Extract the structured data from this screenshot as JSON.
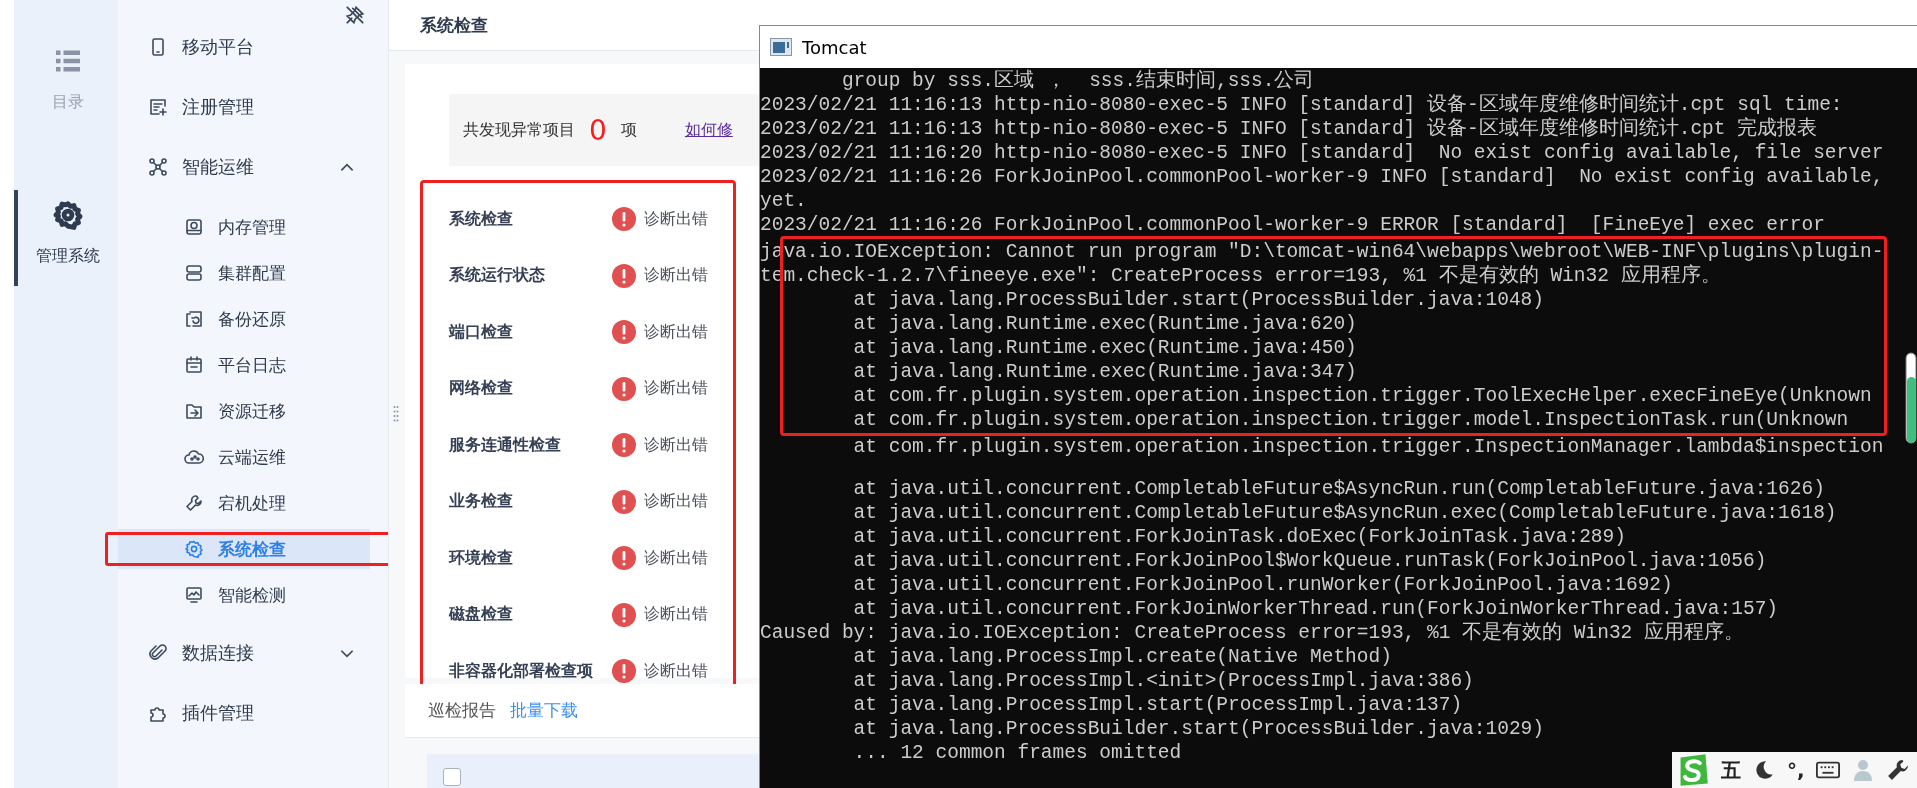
{
  "rail": [
    {
      "label": "目录",
      "selected": false
    },
    {
      "label": "管理系统",
      "selected": true
    }
  ],
  "menu": [
    {
      "label": "移动平台",
      "selected": false,
      "highlighted": false
    },
    {
      "label": "注册管理",
      "selected": false,
      "highlighted": false
    },
    {
      "label": "智能运维",
      "selected": false,
      "highlighted": false,
      "expanded": true,
      "children": [
        {
          "label": "内存管理",
          "selected": false,
          "highlighted": false
        },
        {
          "label": "集群配置",
          "selected": false,
          "highlighted": false
        },
        {
          "label": "备份还原",
          "selected": false,
          "highlighted": false
        },
        {
          "label": "平台日志",
          "selected": false,
          "highlighted": false
        },
        {
          "label": "资源迁移",
          "selected": false,
          "highlighted": false
        },
        {
          "label": "云端运维",
          "selected": false,
          "highlighted": false
        },
        {
          "label": "宕机处理",
          "selected": false,
          "highlighted": false
        },
        {
          "label": "系统检查",
          "selected": true,
          "highlighted": true
        },
        {
          "label": "智能检测",
          "selected": false,
          "highlighted": false
        }
      ]
    },
    {
      "label": "数据连接",
      "selected": false,
      "highlighted": false,
      "expanded": false
    },
    {
      "label": "插件管理",
      "selected": false,
      "highlighted": false
    }
  ],
  "panel": {
    "title": "系统检查",
    "summary": {
      "prefix": "共发现异常项目",
      "count": "0",
      "suffix": "项",
      "link": "如何修"
    },
    "checks_highlighted": true,
    "checks": [
      {
        "name": "系统检查",
        "result": "诊断出错"
      },
      {
        "name": "系统运行状态",
        "result": "诊断出错"
      },
      {
        "name": "端口检查",
        "result": "诊断出错"
      },
      {
        "name": "网络检查",
        "result": "诊断出错"
      },
      {
        "name": "服务连通性检查",
        "result": "诊断出错"
      },
      {
        "name": "业务检查",
        "result": "诊断出错"
      },
      {
        "name": "环境检查",
        "result": "诊断出错"
      },
      {
        "name": "磁盘检查",
        "result": "诊断出错"
      },
      {
        "name": "非容器化部署检查项",
        "result": "诊断出错"
      }
    ],
    "report": {
      "label": "巡检报告",
      "action": "批量下载"
    },
    "table": {
      "select_all": {
        "checked": false
      }
    }
  },
  "console": {
    "title": "Tomcat",
    "blocks": [
      {
        "highlighted": false,
        "lines": [
          "       group by sss.区域 ，  sss.结束时间,sss.公司",
          "2023/02/21 11:16:13 http-nio-8080-exec-5 INFO [standard] 设备-区域年度维修时间统计.cpt sql time:",
          "2023/02/21 11:16:13 http-nio-8080-exec-5 INFO [standard] 设备-区域年度维修时间统计.cpt 完成报表",
          "2023/02/21 11:16:20 http-nio-8080-exec-5 INFO [standard]  No exist config available, file server",
          "2023/02/21 11:16:26 ForkJoinPool.commonPool-worker-9 INFO [standard]  No exist config available,",
          "yet.",
          "2023/02/21 11:16:26 ForkJoinPool.commonPool-worker-9 ERROR [standard]  [FineEye] exec error"
        ]
      },
      {
        "highlighted": true,
        "lines": [
          "java.io.IOException: Cannot run program \"D:\\tomcat-win64\\webapps\\webroot\\WEB-INF\\plugins\\plugin-",
          "tem.check-1.2.7\\fineeye.exe\": CreateProcess error=193, %1 不是有效的 Win32 应用程序。",
          "        at java.lang.ProcessBuilder.start(ProcessBuilder.java:1048)",
          "        at java.lang.Runtime.exec(Runtime.java:620)",
          "        at java.lang.Runtime.exec(Runtime.java:450)",
          "        at java.lang.Runtime.exec(Runtime.java:347)",
          "        at com.fr.plugin.system.operation.inspection.trigger.ToolExecHelper.execFineEye(Unknown",
          "        at com.fr.plugin.system.operation.inspection.trigger.model.InspectionTask.run(Unknown"
        ]
      },
      {
        "highlighted": false,
        "lines": [
          "        at com.fr.plugin.system.operation.inspection.trigger.InspectionManager.lambda$inspection"
        ]
      },
      {
        "highlighted": false,
        "lines": [
          "        at java.util.concurrent.CompletableFuture$AsyncRun.run(CompletableFuture.java:1626)",
          "        at java.util.concurrent.CompletableFuture$AsyncRun.exec(CompletableFuture.java:1618)",
          "        at java.util.concurrent.ForkJoinTask.doExec(ForkJoinTask.java:289)",
          "        at java.util.concurrent.ForkJoinPool$WorkQueue.runTask(ForkJoinPool.java:1056)",
          "        at java.util.concurrent.ForkJoinPool.runWorker(ForkJoinPool.java:1692)",
          "        at java.util.concurrent.ForkJoinWorkerThread.run(ForkJoinWorkerThread.java:157)",
          "Caused by: java.io.IOException: CreateProcess error=193, %1 不是有效的 Win32 应用程序。",
          "        at java.lang.ProcessImpl.create(Native Method)",
          "        at java.lang.ProcessImpl.<init>(ProcessImpl.java:386)",
          "        at java.lang.ProcessImpl.start(ProcessImpl.java:137)",
          "        at java.lang.ProcessBuilder.start(ProcessBuilder.java:1029)",
          "        ... 12 common frames omitted"
        ]
      }
    ]
  },
  "ime_toolbar": {
    "items": [
      {
        "kind": "logo"
      },
      {
        "kind": "text",
        "text": "五"
      },
      {
        "kind": "moon"
      },
      {
        "kind": "text",
        "text": "°,"
      },
      {
        "kind": "keyboard"
      },
      {
        "kind": "person"
      },
      {
        "kind": "wrench"
      }
    ]
  }
}
